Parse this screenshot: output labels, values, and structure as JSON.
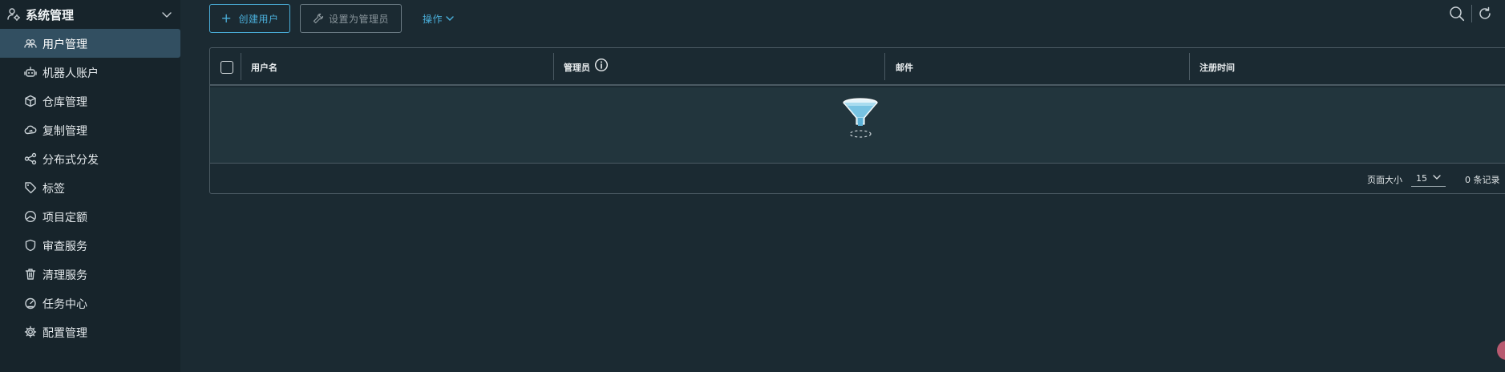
{
  "sidebar": {
    "group_label": "系统管理",
    "items": [
      {
        "label": "用户管理",
        "icon": "users-icon"
      },
      {
        "label": "机器人账户",
        "icon": "robot-icon"
      },
      {
        "label": "仓库管理",
        "icon": "box-icon"
      },
      {
        "label": "复制管理",
        "icon": "cloud-icon"
      },
      {
        "label": "分布式分发",
        "icon": "share-icon"
      },
      {
        "label": "标签",
        "icon": "tag-icon"
      },
      {
        "label": "项目定额",
        "icon": "dashboard-icon"
      },
      {
        "label": "审查服务",
        "icon": "shield-icon"
      },
      {
        "label": "清理服务",
        "icon": "trash-icon"
      },
      {
        "label": "任务中心",
        "icon": "gauge-icon"
      },
      {
        "label": "配置管理",
        "icon": "gear-icon"
      }
    ],
    "active_index": 0
  },
  "toolbar": {
    "create_label": "创建用户",
    "set_admin_label": "设置为管理员",
    "actions_label": "操作"
  },
  "grid": {
    "columns": [
      {
        "label": "用户名"
      },
      {
        "label": "管理员"
      },
      {
        "label": "邮件"
      },
      {
        "label": "注册时间"
      }
    ],
    "rows": []
  },
  "pagination": {
    "page_size_label": "页面大小",
    "page_size": "15",
    "count_text": "0 条记录"
  },
  "colors": {
    "accent": "#4aaed9",
    "background": "#1b2a32",
    "sidebar_bg": "#17242b",
    "active_item": "#324f61"
  }
}
